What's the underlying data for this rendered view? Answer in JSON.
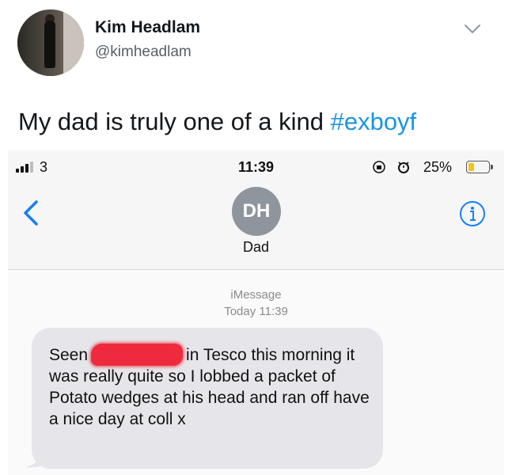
{
  "tweet": {
    "name": "Kim Headlam",
    "handle": "@kimheadlam",
    "text_before": "My dad is truly one of a kind ",
    "hashtag": "#exboyf"
  },
  "phone": {
    "status": {
      "carrier": "3",
      "time": "11:39",
      "battery_percent": "25%",
      "battery_level": 0.25
    },
    "contact": {
      "initials": "DH",
      "name": "Dad"
    },
    "service_label": "iMessage",
    "timestamp": "Today 11:39",
    "message": {
      "part1": "Seen",
      "part2": "in Tesco this morning it was really quite so I lobbed a packet of Potato wedges at his head and ran off have a nice day at coll x"
    }
  },
  "colors": {
    "hashtag": "#1b95e0",
    "ios_blue": "#147efb",
    "bubble": "#e6e5ea",
    "redaction": "#ee2b3e"
  }
}
